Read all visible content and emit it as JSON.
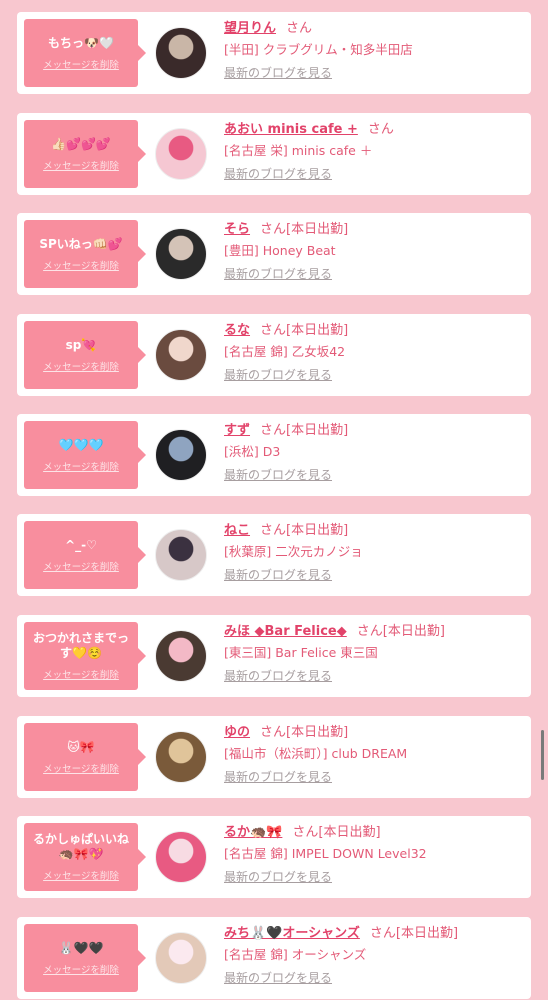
{
  "delete_label": "メッセージを削除",
  "blog_label": "最新のブログを見る",
  "san": "さん",
  "items": [
    {
      "msg": "もちっ🐶🤍",
      "name": "望月りん",
      "status": "",
      "shop": "[半田] クラブグリム・知多半田店",
      "av": [
        "#3a2a2a",
        "#c9b6a7"
      ]
    },
    {
      "msg": "👍🏻💕💕💕",
      "name": "あおい minis cafe +",
      "status": "",
      "shop": "[名古屋 栄] minis cafe ＋",
      "av": [
        "#f5c7d2",
        "#e85a82"
      ]
    },
    {
      "msg": "SPいねっ👊🏻💕",
      "name": "そら",
      "status": "[本日出勤]",
      "shop": "[豊田] Honey Beat",
      "av": [
        "#2a2a2a",
        "#d4c3b7"
      ]
    },
    {
      "msg": "sp💘",
      "name": "るな",
      "status": "[本日出勤]",
      "shop": "[名古屋 錦] 乙女坂42",
      "av": [
        "#6a4b3f",
        "#f0d7cc"
      ]
    },
    {
      "msg": "🩵🩵🩵",
      "name": "すず",
      "status": "[本日出勤]",
      "shop": "[浜松] D3",
      "av": [
        "#1f1f22",
        "#8fa4c0"
      ]
    },
    {
      "msg": "^_-♡",
      "name": "ねこ",
      "status": "[本日出勤]",
      "shop": "[秋葉原] 二次元カノジョ",
      "av": [
        "#d7c8c8",
        "#3b3140"
      ]
    },
    {
      "msg": "おつかれさまでっす💛☺️",
      "name": "みほ ◆Bar Felice◆",
      "status": "[本日出勤]",
      "shop": "[東三国] Bar Felice 東三国",
      "av": [
        "#4a3a32",
        "#f3b9c6"
      ]
    },
    {
      "msg": "🐱🎀",
      "name": "ゆの",
      "status": "[本日出勤]",
      "shop": "[福山市（松浜町）] club DREAM",
      "av": [
        "#7a5a3a",
        "#e0c49a"
      ]
    },
    {
      "msg": "るかしゅぱいいね🦔🎀💖",
      "name": "るか🦔🎀",
      "status": "[本日出勤]",
      "shop": "[名古屋 錦] IMPEL DOWN Level32",
      "av": [
        "#e85a82",
        "#f7dbe3"
      ]
    },
    {
      "msg": "🐰🖤🖤",
      "name": "みち🐰🖤オーシャンズ",
      "status": "[本日出勤]",
      "shop": "[名古屋 錦] オーシャンズ",
      "av": [
        "#e3c9b8",
        "#fbe9ef"
      ]
    }
  ]
}
